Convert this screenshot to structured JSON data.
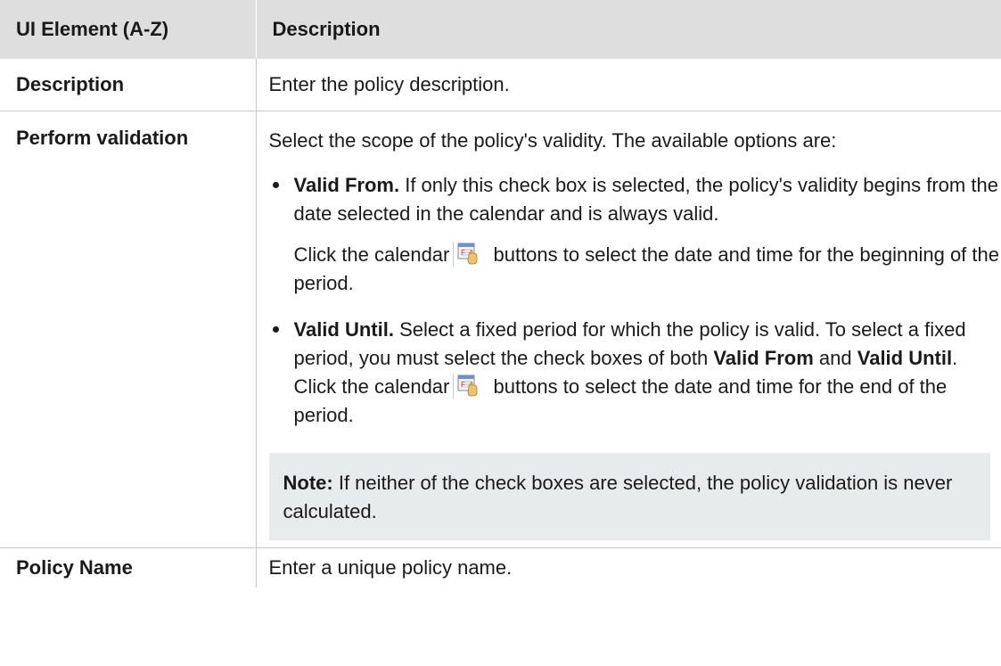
{
  "table": {
    "headers": [
      "UI Element (A-Z)",
      "Description"
    ],
    "rows": [
      {
        "name": "Description",
        "text": "Enter the policy description."
      },
      {
        "name": "Perform validation",
        "intro": "Select the scope of the policy's validity. The available options are:",
        "options": [
          {
            "term": "Valid From.",
            "text": " If only this check box is selected, the policy's validity begins from the date selected in the calendar and is always valid.",
            "sub_before": "Click the calendar",
            "sub_after": " buttons to select the date and time for the beginning of the period."
          },
          {
            "term": "Valid Until.",
            "text1": " Select a fixed period for which the policy is valid. To select a fixed period, you must select the check boxes of both ",
            "bold1": "Valid From",
            "text2": " and ",
            "bold2": "Valid Until",
            "text3": ". Click the calendar",
            "text4": " buttons to select the date and time for the end of the period."
          }
        ],
        "note_label": "Note:",
        "note_text": " If neither of the check boxes are selected, the policy validation is never calculated."
      },
      {
        "name": "Policy Name",
        "text": "Enter a unique policy name."
      }
    ]
  },
  "icons": {
    "calendar": "calendar-icon"
  },
  "colors": {
    "header_bg": "#dedede",
    "note_bg": "#e8ebeb",
    "border": "#c8c8c8"
  }
}
